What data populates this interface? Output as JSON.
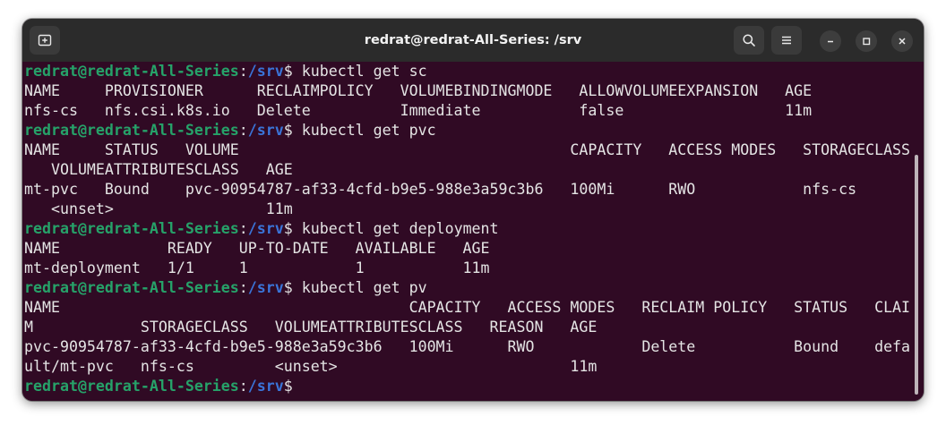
{
  "window": {
    "title": "redrat@redrat-All-Series: /srv",
    "buttons": {
      "new_tab_icon": "new-tab-icon",
      "search_icon": "search-icon",
      "menu_icon": "hamburger-menu-icon",
      "minimize_icon": "minimize-icon",
      "maximize_icon": "maximize-icon",
      "close_icon": "close-icon"
    }
  },
  "colors": {
    "terminal_bg": "#300a24",
    "prompt_user": "#26a269",
    "prompt_path": "#3a74d8",
    "text": "#e4e4e4",
    "titlebar": "#2b2b2b"
  },
  "prompt": {
    "user_host": "redrat@redrat-All-Series",
    "sep": ":",
    "path": "/srv",
    "sigil": "$"
  },
  "terminal": {
    "lines": [
      {
        "kind": "cmd",
        "text": " kubectl get sc"
      },
      {
        "kind": "out",
        "text": "NAME     PROVISIONER      RECLAIMPOLICY   VOLUMEBINDINGMODE   ALLOWVOLUMEEXPANSION   AGE"
      },
      {
        "kind": "out",
        "text": "nfs-cs   nfs.csi.k8s.io   Delete          Immediate           false                  11m"
      },
      {
        "kind": "cmd",
        "text": " kubectl get pvc"
      },
      {
        "kind": "out",
        "text": "NAME     STATUS   VOLUME                                     CAPACITY   ACCESS MODES   STORAGECLASS"
      },
      {
        "kind": "out",
        "text": "   VOLUMEATTRIBUTESCLASS   AGE"
      },
      {
        "kind": "out",
        "text": "mt-pvc   Bound    pvc-90954787-af33-4cfd-b9e5-988e3a59c3b6   100Mi      RWO            nfs-cs"
      },
      {
        "kind": "out",
        "text": "   <unset>                 11m"
      },
      {
        "kind": "cmd",
        "text": " kubectl get deployment"
      },
      {
        "kind": "out",
        "text": "NAME            READY   UP-TO-DATE   AVAILABLE   AGE"
      },
      {
        "kind": "out",
        "text": "mt-deployment   1/1     1            1           11m"
      },
      {
        "kind": "cmd",
        "text": " kubectl get pv"
      },
      {
        "kind": "out",
        "text": "NAME                                       CAPACITY   ACCESS MODES   RECLAIM POLICY   STATUS   CLAI"
      },
      {
        "kind": "out",
        "text": "M            STORAGECLASS   VOLUMEATTRIBUTESCLASS   REASON   AGE"
      },
      {
        "kind": "out",
        "text": "pvc-90954787-af33-4cfd-b9e5-988e3a59c3b6   100Mi      RWO            Delete           Bound    defa"
      },
      {
        "kind": "out",
        "text": "ult/mt-pvc   nfs-cs         <unset>                          11m"
      },
      {
        "kind": "cmd",
        "text": ""
      }
    ]
  }
}
